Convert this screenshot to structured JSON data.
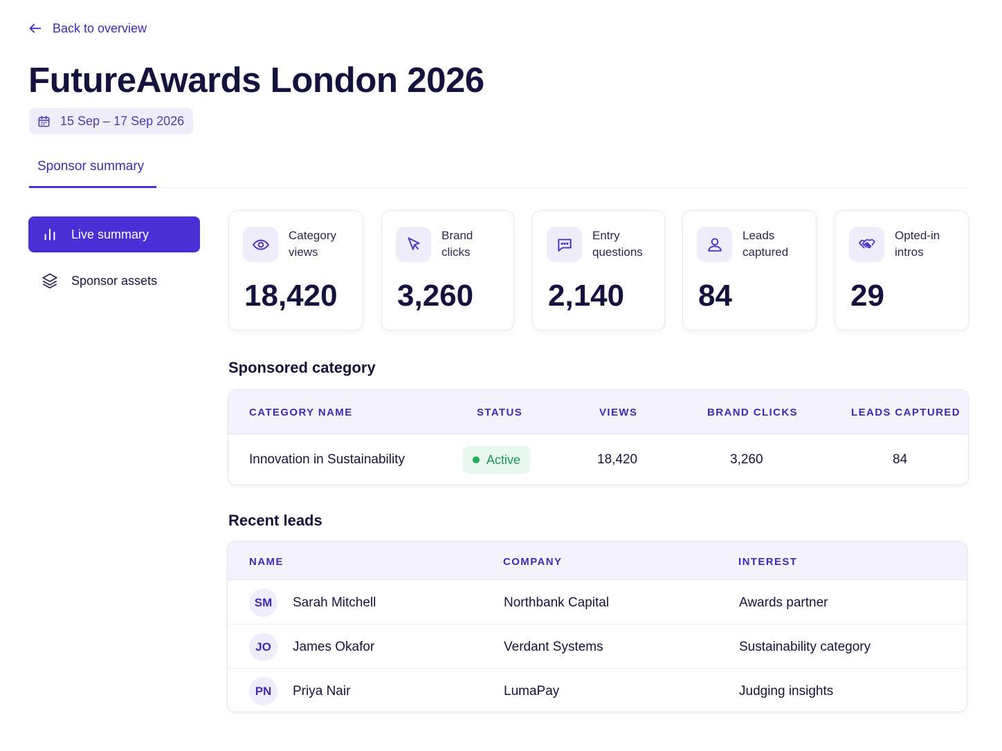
{
  "nav": {
    "back_label": "Back to overview"
  },
  "event": {
    "title": "FutureAwards London 2026",
    "dates": "15 Sep – 17 Sep 2026"
  },
  "tabs": [
    {
      "label": "Sponsor summary",
      "active": true
    }
  ],
  "sidebar": {
    "items": [
      {
        "label": "Live summary",
        "icon": "bar-chart-icon",
        "active": true
      },
      {
        "label": "Sponsor assets",
        "icon": "layers-icon",
        "active": false
      }
    ]
  },
  "stats": [
    {
      "label": "Category\nviews",
      "value": "18,420",
      "icon": "eye-icon"
    },
    {
      "label": "Brand\nclicks",
      "value": "3,260",
      "icon": "cursor-icon"
    },
    {
      "label": "Entry\nquestions",
      "value": "2,140",
      "icon": "chat-icon"
    },
    {
      "label": "Leads\ncaptured",
      "value": "84",
      "icon": "user-icon"
    },
    {
      "label": "Opted-in\nintros",
      "value": "29",
      "icon": "handshake-icon"
    }
  ],
  "sponsored": {
    "title": "Sponsored category",
    "columns": [
      "CATEGORY NAME",
      "STATUS",
      "VIEWS",
      "BRAND CLICKS",
      "LEADS CAPTURED"
    ],
    "rows": [
      {
        "name": "Innovation in Sustainability",
        "status": "Active",
        "views": "18,420",
        "brand_clicks": "3,260",
        "leads": "84"
      }
    ]
  },
  "leads": {
    "title": "Recent leads",
    "columns": [
      "NAME",
      "COMPANY",
      "INTEREST"
    ],
    "rows": [
      {
        "initials": "SM",
        "name": "Sarah Mitchell",
        "company": "Northbank Capital",
        "interest": "Awards partner"
      },
      {
        "initials": "JO",
        "name": "James Okafor",
        "company": "Verdant Systems",
        "interest": "Sustainability category"
      },
      {
        "initials": "PN",
        "name": "Priya Nair",
        "company": "LumaPay",
        "interest": "Judging insights"
      }
    ]
  },
  "colors": {
    "accent": "#4a2fd6",
    "accent_text": "#3d2bb8",
    "success": "#1fae5c",
    "ink": "#14133d"
  }
}
